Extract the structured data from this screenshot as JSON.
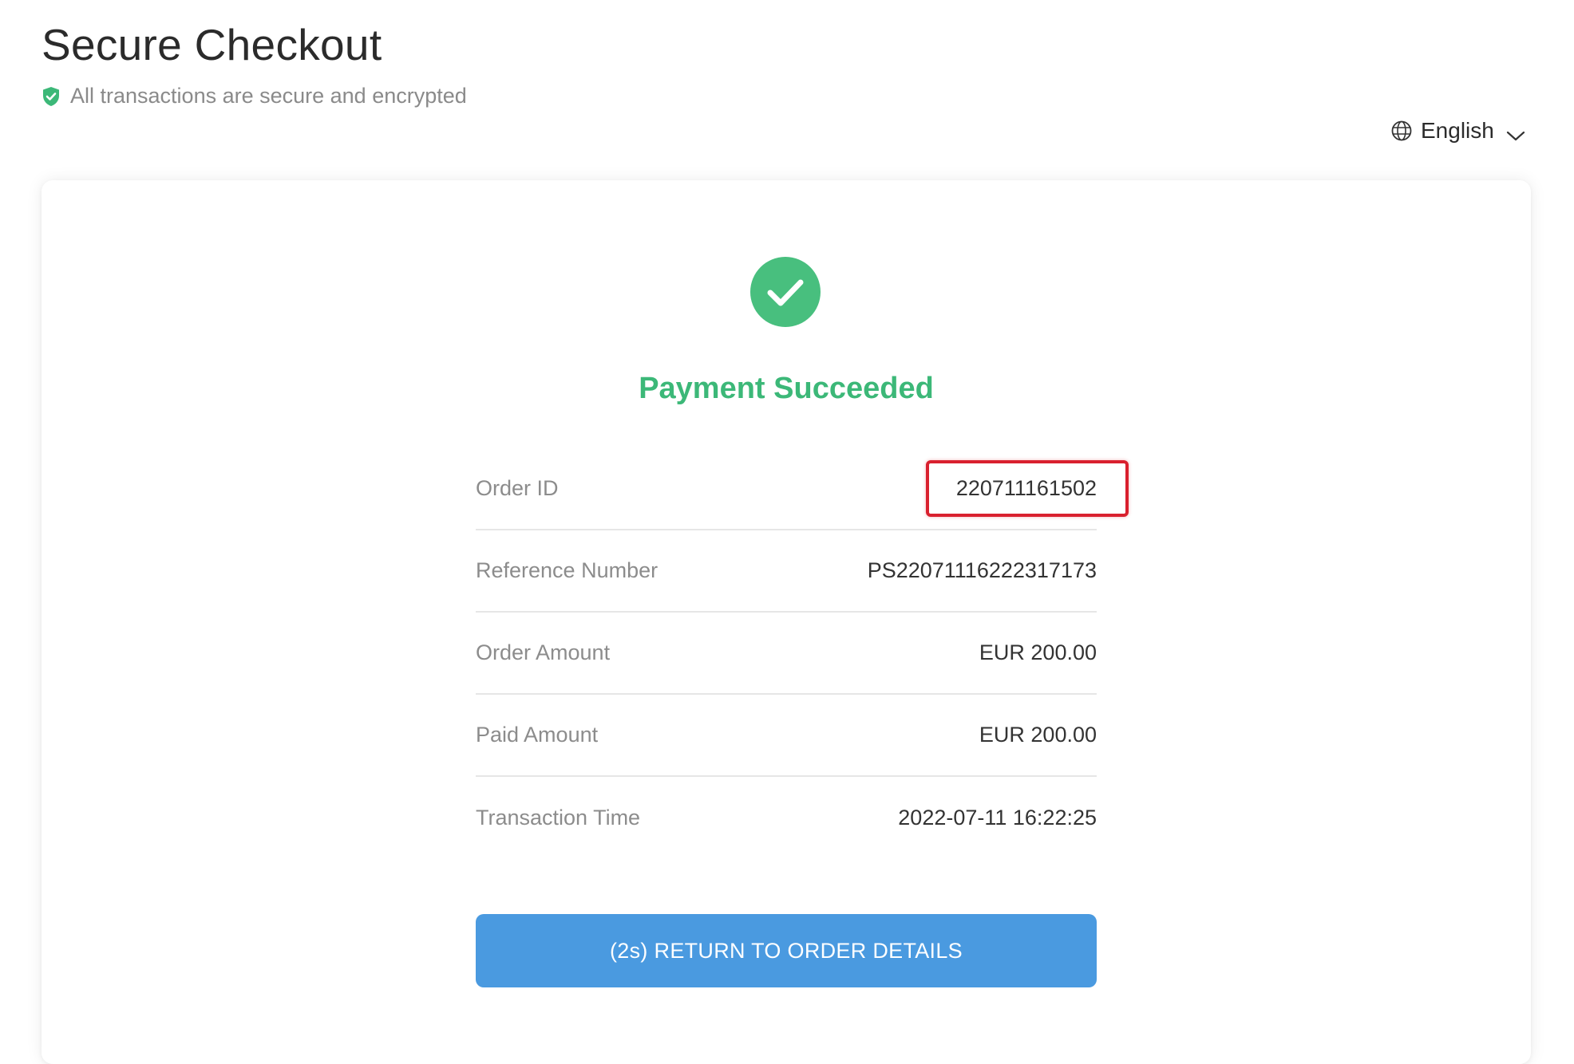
{
  "header": {
    "title": "Secure Checkout",
    "secure_text": "All transactions are secure and encrypted",
    "language": "English"
  },
  "result": {
    "status_title": "Payment Succeeded",
    "rows": [
      {
        "label": "Order ID",
        "value": "220711161502"
      },
      {
        "label": "Reference Number",
        "value": "PS22071116222317173"
      },
      {
        "label": "Order Amount",
        "value": "EUR 200.00"
      },
      {
        "label": "Paid Amount",
        "value": "EUR 200.00"
      },
      {
        "label": "Transaction Time",
        "value": "2022-07-11 16:22:25"
      }
    ],
    "button_label": "(2s) RETURN TO ORDER DETAILS"
  },
  "icons": {
    "shield": "shield-check-icon",
    "globe": "globe-icon",
    "chevron": "chevron-down-icon",
    "success": "check-circle-icon"
  },
  "colors": {
    "success_green": "#3cb878",
    "button_blue": "#4a9ae0",
    "highlight_red": "#d9202e"
  }
}
